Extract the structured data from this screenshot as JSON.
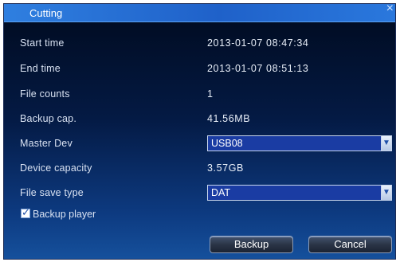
{
  "dialog": {
    "title": "Cutting",
    "close_glyph": "×"
  },
  "fields": {
    "start_time": {
      "label": "Start time",
      "value": "2013-01-07 08:47:34"
    },
    "end_time": {
      "label": "End time",
      "value": "2013-01-07 08:51:13"
    },
    "file_counts": {
      "label": "File counts",
      "value": "1"
    },
    "backup_cap": {
      "label": "Backup cap.",
      "value": "41.56MB"
    },
    "master_dev": {
      "label": "Master Dev",
      "selected": "USB08"
    },
    "device_capacity": {
      "label": "Device capacity",
      "value": "3.57GB"
    },
    "file_save_type": {
      "label": "File save type",
      "selected": "DAT"
    }
  },
  "backup_player": {
    "label": "Backup player",
    "checked": true,
    "check_glyph": "✓"
  },
  "buttons": {
    "backup": "Backup",
    "cancel": "Cancel"
  },
  "icons": {
    "dropdown": "chevron-down-icon",
    "close": "close-icon",
    "check": "check-icon"
  },
  "colors": {
    "titlebar": "#2a6fd6",
    "panel": "#041a44",
    "accent_select": "#1a3ca3"
  }
}
